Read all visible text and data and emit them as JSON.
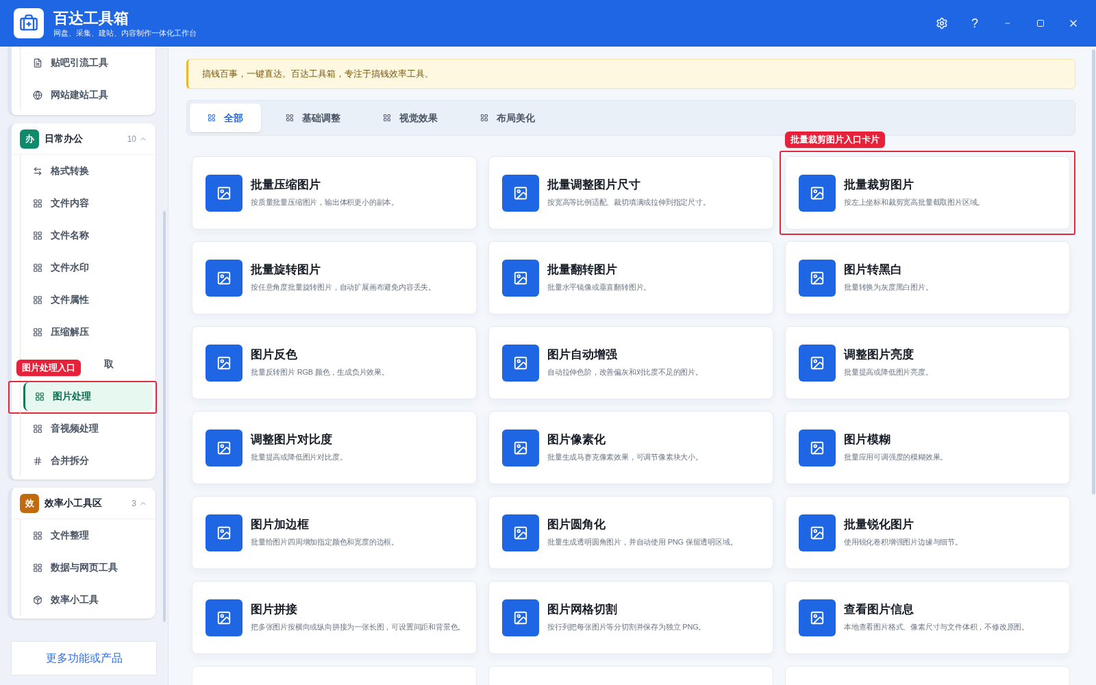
{
  "app": {
    "title": "百达工具箱",
    "subtitle": "网盘、采集、建站、内容制作一体化工作台",
    "help": "?"
  },
  "sidebar": {
    "groups": [
      {
        "items": [
          {
            "label": "贴吧引流工具",
            "kind": "note",
            "selected": false
          },
          {
            "label": "网站建站工具",
            "kind": "globe",
            "selected": false
          }
        ]
      },
      {
        "badge": "办",
        "color": "#0f8a6a",
        "name": "日常办公",
        "count": "10",
        "expanded": true,
        "items": [
          {
            "label": "格式转换",
            "kind": "swap",
            "selected": false
          },
          {
            "label": "文件内容",
            "kind": "grid",
            "selected": false
          },
          {
            "label": "文件名称",
            "kind": "grid",
            "selected": false
          },
          {
            "label": "文件水印",
            "kind": "grid",
            "selected": false
          },
          {
            "label": "文件属性",
            "kind": "grid",
            "selected": false
          },
          {
            "label": "压缩解压",
            "kind": "grid",
            "selected": false
          },
          {
            "label": "取",
            "kind": "covered",
            "selected": false
          },
          {
            "label": "图片处理",
            "kind": "grid",
            "selected": true,
            "callout": "图片处理入口"
          },
          {
            "label": "音视频处理",
            "kind": "grid",
            "selected": false
          },
          {
            "label": "合并拆分",
            "kind": "hash",
            "selected": false
          }
        ]
      },
      {
        "badge": "效",
        "color": "#c26a10",
        "name": "效率小工具区",
        "count": "3",
        "expanded": true,
        "items": [
          {
            "label": "文件整理",
            "kind": "grid",
            "selected": false
          },
          {
            "label": "数据与网页工具",
            "kind": "grid",
            "selected": false
          },
          {
            "label": "效率小工具",
            "kind": "box",
            "selected": false
          }
        ]
      }
    ],
    "more_button": "更多功能或产品"
  },
  "notice": "搞钱百事，一键直达。百达工具箱，专注于搞钱效率工具。",
  "tabs": [
    {
      "label": "全部",
      "selected": true
    },
    {
      "label": "基础调整",
      "selected": false
    },
    {
      "label": "视觉效果",
      "selected": false
    },
    {
      "label": "布局美化",
      "selected": false
    }
  ],
  "cards": [
    {
      "kind": "tool",
      "title": "批量压缩图片",
      "desc": "按质量批量压缩图片，输出体积更小的副本。"
    },
    {
      "kind": "tool",
      "title": "批量调整图片尺寸",
      "desc": "按宽高等比例适配、裁切填满或拉伸到指定尺寸。"
    },
    {
      "kind": "tool",
      "title": "批量裁剪图片",
      "desc": "按左上坐标和裁剪宽高批量截取图片区域。",
      "callout": "批量裁剪图片入口卡片"
    },
    {
      "kind": "tool",
      "title": "批量旋转图片",
      "desc": "按任意角度批量旋转图片，自动扩展画布避免内容丢失。"
    },
    {
      "kind": "tool",
      "title": "批量翻转图片",
      "desc": "批量水平镜像或垂直翻转图片。"
    },
    {
      "kind": "tool",
      "title": "图片转黑白",
      "desc": "批量转换为灰度黑白图片。"
    },
    {
      "kind": "tool",
      "title": "图片反色",
      "desc": "批量反转图片 RGB 颜色，生成负片效果。"
    },
    {
      "kind": "tool",
      "title": "图片自动增强",
      "desc": "自动拉伸色阶，改善偏灰和对比度不足的图片。"
    },
    {
      "kind": "tool",
      "title": "调整图片亮度",
      "desc": "批量提高或降低图片亮度。"
    },
    {
      "kind": "tool",
      "title": "调整图片对比度",
      "desc": "批量提高或降低图片对比度。"
    },
    {
      "kind": "tool",
      "title": "图片像素化",
      "desc": "批量生成马赛克像素效果，可调节像素块大小。"
    },
    {
      "kind": "tool",
      "title": "图片模糊",
      "desc": "批量应用可调强度的模糊效果。"
    },
    {
      "kind": "tool",
      "title": "图片加边框",
      "desc": "批量给图片四周增加指定颜色和宽度的边框。"
    },
    {
      "kind": "tool",
      "title": "图片圆角化",
      "desc": "批量生成透明圆角图片，并自动使用 PNG 保留透明区域。"
    },
    {
      "kind": "tool",
      "title": "批量锐化图片",
      "desc": "使用锐化卷积增强图片边缘与细节。"
    },
    {
      "kind": "tool",
      "title": "图片拼接",
      "desc": "把多张图片按横向或纵向拼接为一张长图，可设置间距和背景色。"
    },
    {
      "kind": "tool",
      "title": "图片网格切割",
      "desc": "按行列把每张图片等分切割并保存为独立 PNG。"
    },
    {
      "kind": "tool",
      "title": "查看图片信息",
      "desc": "本地查看图片格式、像素尺寸与文件体积，不修改原图。"
    },
    {
      "kind": "cut"
    },
    {
      "kind": "cut"
    },
    {
      "kind": "cut"
    }
  ]
}
